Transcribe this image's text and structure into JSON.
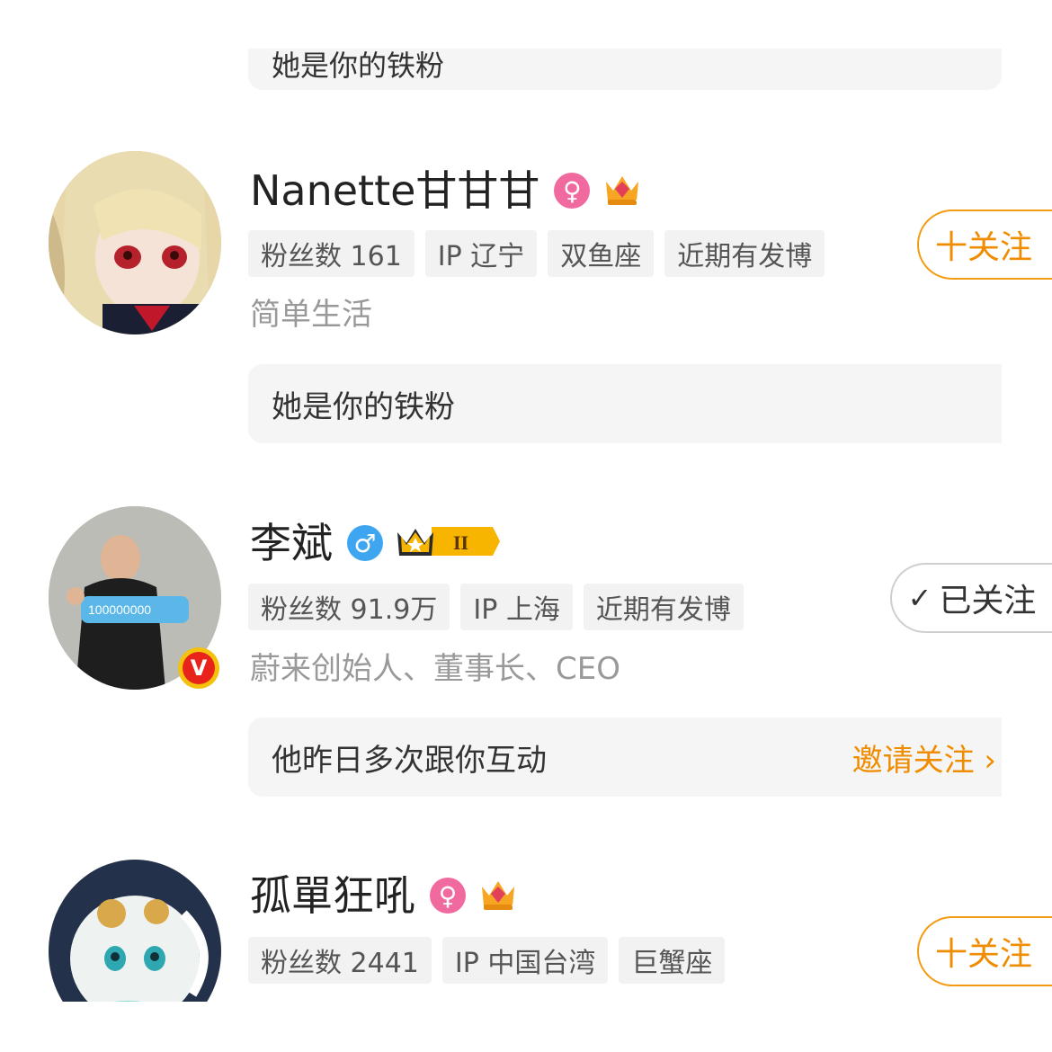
{
  "top_note": {
    "text": "她是你的铁粉"
  },
  "users": [
    {
      "name": "Nanette甘甘甘",
      "gender": "♀",
      "badge_level": "2",
      "tags": [
        "粉丝数 161",
        "IP 辽宁",
        "双鱼座",
        "近期有发博"
      ],
      "bio": "简单生活",
      "button": "十关注",
      "note": "她是你的铁粉"
    },
    {
      "name": "李斌",
      "gender": "♂",
      "badge_level": "II",
      "verified": "V",
      "tags": [
        "粉丝数 91.9万",
        "IP 上海",
        "近期有发博"
      ],
      "bio": "蔚来创始人、董事长、CEO",
      "button": "已关注",
      "note": "他昨日多次跟你互动",
      "note_action": "邀请关注 ›"
    },
    {
      "name": "孤單狂吼",
      "gender": "♀",
      "badge_level": "1",
      "tags": [
        "粉丝数 2441",
        "IP 中国台湾",
        "巨蟹座"
      ],
      "button": "十关注"
    }
  ],
  "colors": {
    "accent": "#f08c00",
    "female": "#f06aa0",
    "male": "#3ea6f0",
    "tag_bg": "#f2f2f2"
  }
}
